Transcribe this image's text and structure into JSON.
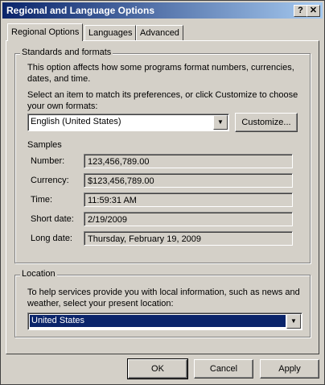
{
  "window": {
    "title": "Regional and Language Options"
  },
  "titlebar": {
    "help": "?",
    "close": "✕"
  },
  "tabs": [
    {
      "label": "Regional Options",
      "active": true
    },
    {
      "label": "Languages",
      "active": false
    },
    {
      "label": "Advanced",
      "active": false
    }
  ],
  "standards": {
    "legend": "Standards and formats",
    "description": "This option affects how some programs format numbers, currencies, dates, and time.",
    "select_prompt_line1": "Select an item to match its preferences, or click Customize to choose",
    "select_prompt_line2": "your own formats:",
    "format_value": "English (United States)",
    "customize_label": "Customize...",
    "samples_label": "Samples",
    "samples": [
      {
        "label": "Number:",
        "value": "123,456,789.00"
      },
      {
        "label": "Currency:",
        "value": "$123,456,789.00"
      },
      {
        "label": "Time:",
        "value": "11:59:31 AM"
      },
      {
        "label": "Short date:",
        "value": "2/19/2009"
      },
      {
        "label": "Long date:",
        "value": "Thursday, February 19, 2009"
      }
    ]
  },
  "location": {
    "legend": "Location",
    "description_line1": "To help services provide you with local information, such as news and",
    "description_line2": "weather, select your present location:",
    "value": "United States"
  },
  "buttons": {
    "ok": "OK",
    "cancel": "Cancel",
    "apply": "Apply"
  },
  "icons": {
    "dropdown": "▼"
  },
  "colors": {
    "title_start": "#0a246a",
    "title_end": "#a6caf0",
    "selection": "#0a246a",
    "face": "#d4d0c8"
  }
}
